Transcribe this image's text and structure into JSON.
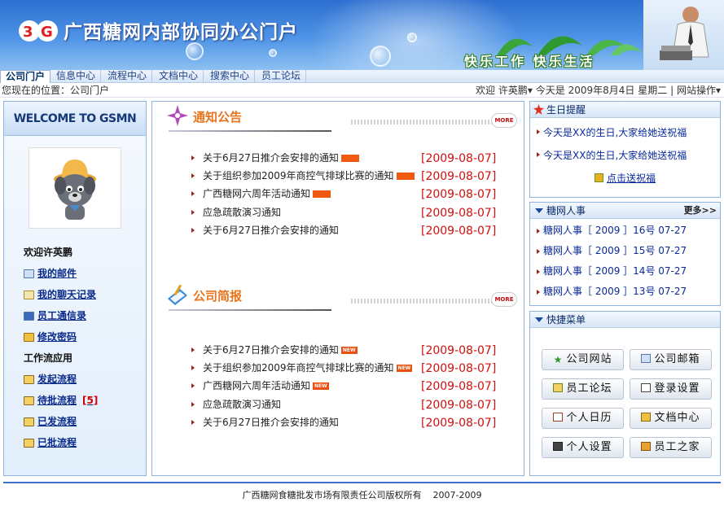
{
  "header": {
    "title": "广西糖网内部协同办公门户",
    "slogan": "快乐工作 快乐生活"
  },
  "nav": {
    "tabs": [
      "公司门户",
      "信息中心",
      "流程中心",
      "文档中心",
      "搜索中心",
      "员工论坛"
    ]
  },
  "location": {
    "text": "您现在的位置：公司门户"
  },
  "userbar": {
    "greeting": "欢迎",
    "user": "许英鹏",
    "arrow": "▾",
    "today": "今天是",
    "date": "2009年8月4日",
    "weekday": "星期二",
    "sep": "|",
    "site_ops": "网站操作",
    "caret": "▾"
  },
  "left": {
    "welcome": "WELCOME TO GSMN",
    "welcome_user": "欢迎许英鹏",
    "links": [
      {
        "label": "我的邮件",
        "icon": "mail-icon"
      },
      {
        "label": "我的聊天记录",
        "icon": "chat-icon"
      },
      {
        "label": "员工通信录",
        "icon": "contacts-icon"
      },
      {
        "label": "修改密码",
        "icon": "key-icon"
      }
    ],
    "workflow_title": "工作流应用",
    "workflow": [
      {
        "label": "发起流程",
        "count": ""
      },
      {
        "label": "待批流程",
        "count": "[5]"
      },
      {
        "label": "已发流程",
        "count": ""
      },
      {
        "label": "已批流程",
        "count": ""
      }
    ]
  },
  "notices": {
    "title": "通知公告",
    "more": "MORE",
    "items": [
      {
        "text": "关于6月27日推介会安排的通知",
        "date": "[2009-08-07]",
        "flag": true
      },
      {
        "text": "关于组织参加2009年商控气排球比赛的通知",
        "date": "[2009-08-07]",
        "flag": true
      },
      {
        "text": "广西糖网六周年活动通知",
        "date": "[2009-08-07]",
        "flag": true
      },
      {
        "text": "应急疏散演习通知",
        "date": "[2009-08-07]",
        "flag": false
      },
      {
        "text": "关于6月27日推介会安排的通知",
        "date": "[2009-08-07]",
        "flag": false
      }
    ]
  },
  "brief": {
    "title": "公司简报",
    "more": "MORE",
    "new_label": "NEW",
    "items": [
      {
        "text": "关于6月27日推介会安排的通知",
        "date": "[2009-08-07]",
        "isnew": true
      },
      {
        "text": "关于组织参加2009年商控气排球比赛的通知",
        "date": "[2009-08-07]",
        "isnew": true
      },
      {
        "text": "广西糖网六周年活动通知",
        "date": "[2009-08-07]",
        "isnew": true
      },
      {
        "text": "应急疏散演习通知",
        "date": "[2009-08-07]",
        "isnew": false
      },
      {
        "text": "关于6月27日推介会安排的通知",
        "date": "[2009-08-07]",
        "isnew": false
      }
    ]
  },
  "birthday": {
    "title": "生日提醒",
    "items": [
      "今天是XX的生日,大家给她送祝福",
      "今天是XX的生日,大家给她送祝福"
    ],
    "send": "点击送祝福"
  },
  "hr": {
    "title": "糖网人事",
    "more": "更多>>",
    "items": [
      "糖网人事［ 2009 ］16号 07-27",
      "糖网人事［ 2009 ］15号 07-27",
      "糖网人事［ 2009 ］14号 07-27",
      "糖网人事［ 2009 ］13号 07-27"
    ]
  },
  "quick": {
    "title": "快捷菜单",
    "buttons": [
      {
        "label": "公司网站",
        "icon": "star-icon"
      },
      {
        "label": "公司邮箱",
        "icon": "mail-icon"
      },
      {
        "label": "员工论坛",
        "icon": "forum-icon"
      },
      {
        "label": "登录设置",
        "icon": "login-icon"
      },
      {
        "label": "个人日历",
        "icon": "calendar-icon"
      },
      {
        "label": "文档中心",
        "icon": "folder-icon"
      },
      {
        "label": "个人设置",
        "icon": "settings-icon"
      },
      {
        "label": "员工之家",
        "icon": "home-icon"
      }
    ]
  },
  "footer": {
    "copyright": "广西糖网食糖批发市场有限责任公司版权所有",
    "years": "2007-2009"
  },
  "colors": {
    "accent": "#2d6fd0",
    "date_red": "#d01010",
    "title_orange": "#e8741e",
    "link_blue": "#0a2a9a"
  }
}
